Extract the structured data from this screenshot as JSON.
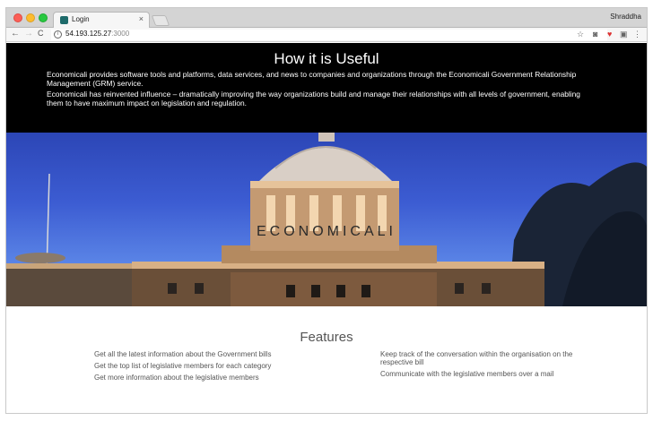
{
  "browser": {
    "tab_title": "Login",
    "tab_close": "×",
    "user_name": "Shraddha",
    "url_host": "54.193.125.27",
    "url_port": ":3000",
    "nav": {
      "back": "←",
      "forward": "→",
      "reload": "C"
    },
    "icons": {
      "bookmark": "☆",
      "camera": "◙",
      "extension": "♥",
      "cast": "▣",
      "menu": "⋮"
    }
  },
  "hero": {
    "title": "How it is Useful",
    "paragraphs": [
      "Economicali provides software tools and platforms, data services, and news to companies and organizations through the Economicali Government Relationship Management (GRM) service.",
      "Economicali has reinvented influence – dramatically improving the way organizations build and manage their relationships with all levels of government, enabling them to have maximum impact on legislation and regulation."
    ]
  },
  "banner": {
    "brand": "ECONOMICALI"
  },
  "features": {
    "title": "Features",
    "left": [
      "Get all the latest information about the Government bills",
      "Get the top list of legislative members for each category",
      "Get more information about the legislative members"
    ],
    "right": [
      "Keep track of the conversation within the organisation on the respective bill",
      "Communicate with the legislative members over a mail"
    ]
  }
}
